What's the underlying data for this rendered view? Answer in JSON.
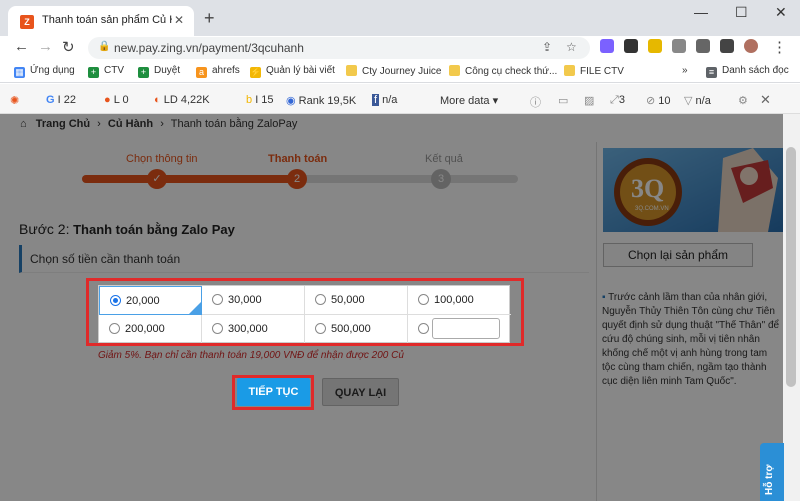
{
  "browser": {
    "tab_title": "Thanh toán sản phẩm Củ Hành",
    "tab_close": "✕",
    "new_tab": "+",
    "url": "new.pay.zing.vn/payment/3qcuhanh",
    "window_controls": [
      "—",
      "☐",
      "✕"
    ]
  },
  "bookmarks": [
    {
      "label": "Ứng dụng",
      "icon": "apps-icon",
      "color": "#4285f4"
    },
    {
      "label": "CTV",
      "icon": "sheets-icon",
      "color": "#1e8e3e"
    },
    {
      "label": "Duyệt",
      "icon": "sheets-icon",
      "color": "#1e8e3e"
    },
    {
      "label": "ahrefs",
      "icon": "ahrefs-icon",
      "color": "#f7941d"
    },
    {
      "label": "Quản lý bài viết",
      "icon": "bolt-icon",
      "color": "#f2b705"
    },
    {
      "label": "Cty Journey Juice",
      "icon": "folder-icon",
      "color": "#f2c94c"
    },
    {
      "label": "Công cụ check thứ...",
      "icon": "folder-icon",
      "color": "#f2c94c"
    },
    {
      "label": "FILE CTV",
      "icon": "folder-icon",
      "color": "#f2c94c"
    },
    {
      "label": "Danh sách đọc",
      "icon": "reading-list-icon",
      "color": "#5f6368"
    }
  ],
  "seo_bar": {
    "items": [
      {
        "icon": "google-icon",
        "label": "I 22"
      },
      {
        "icon": "circle-icon",
        "label": "L 0"
      },
      {
        "icon": "links-icon",
        "label": "LD 4,22K"
      },
      {
        "icon": "bing-icon",
        "label": "I 15"
      },
      {
        "icon": "rank-icon",
        "label": "Rank 19,5K"
      },
      {
        "icon": "facebook-icon",
        "label": "n/a"
      }
    ],
    "more": "More data ▾",
    "right_items": [
      {
        "icon": "link-icon",
        "label": "3"
      },
      {
        "icon": "page-icon",
        "label": "10"
      },
      {
        "icon": "social-icon",
        "label": "n/a"
      }
    ]
  },
  "breadcrumb": {
    "home": "Trang Chủ",
    "sep": "›",
    "level1": "Củ Hành",
    "level2": "Thanh toán bằng ZaloPay"
  },
  "steps": [
    {
      "label": "Chọn thông tin",
      "marker": "✓",
      "state": "done"
    },
    {
      "label": "Thanh toán",
      "marker": "2",
      "state": "active"
    },
    {
      "label": "Kết quả",
      "marker": "3",
      "state": "todo"
    }
  ],
  "step_heading": {
    "prefix": "Bước 2:",
    "title": " Thanh toán bằng Zalo Pay"
  },
  "amount_section": {
    "title": "Chọn số tiền cần thanh toán",
    "options": [
      "20,000",
      "30,000",
      "50,000",
      "100,000",
      "200,000",
      "300,000",
      "500,000"
    ],
    "selected": "20,000",
    "custom_value": ""
  },
  "discount_note": "Giảm 5%. Bạn chỉ cần thanh toán 19,000 VNĐ để nhận được 200 Củ",
  "buttons": {
    "continue": "TIẾP TỤC",
    "back": "QUAY LẠI"
  },
  "sidebar": {
    "banner_text": "3Q",
    "banner_sub": "3Q.COM.VN",
    "choose_again": "Chọn lại sản phẩm",
    "description": "Trước cảnh lầm than của nhân giới, Nguyễn Thủy Thiên Tôn cùng chư Tiên quyết định sử dụng thuật \"Thế Thân\" để cứu độ chúng sinh, mỗi vị tiên nhân khống chế một vị anh hùng trong tam tộc cùng tham chiến, ngầm tạo thành cục diện liên minh Tam Quốc\"."
  },
  "help_button": "Hỗ trợ",
  "colors": {
    "brand": "#e8541c",
    "primary_button": "#1a9be6",
    "highlight": "#e02a2a"
  }
}
